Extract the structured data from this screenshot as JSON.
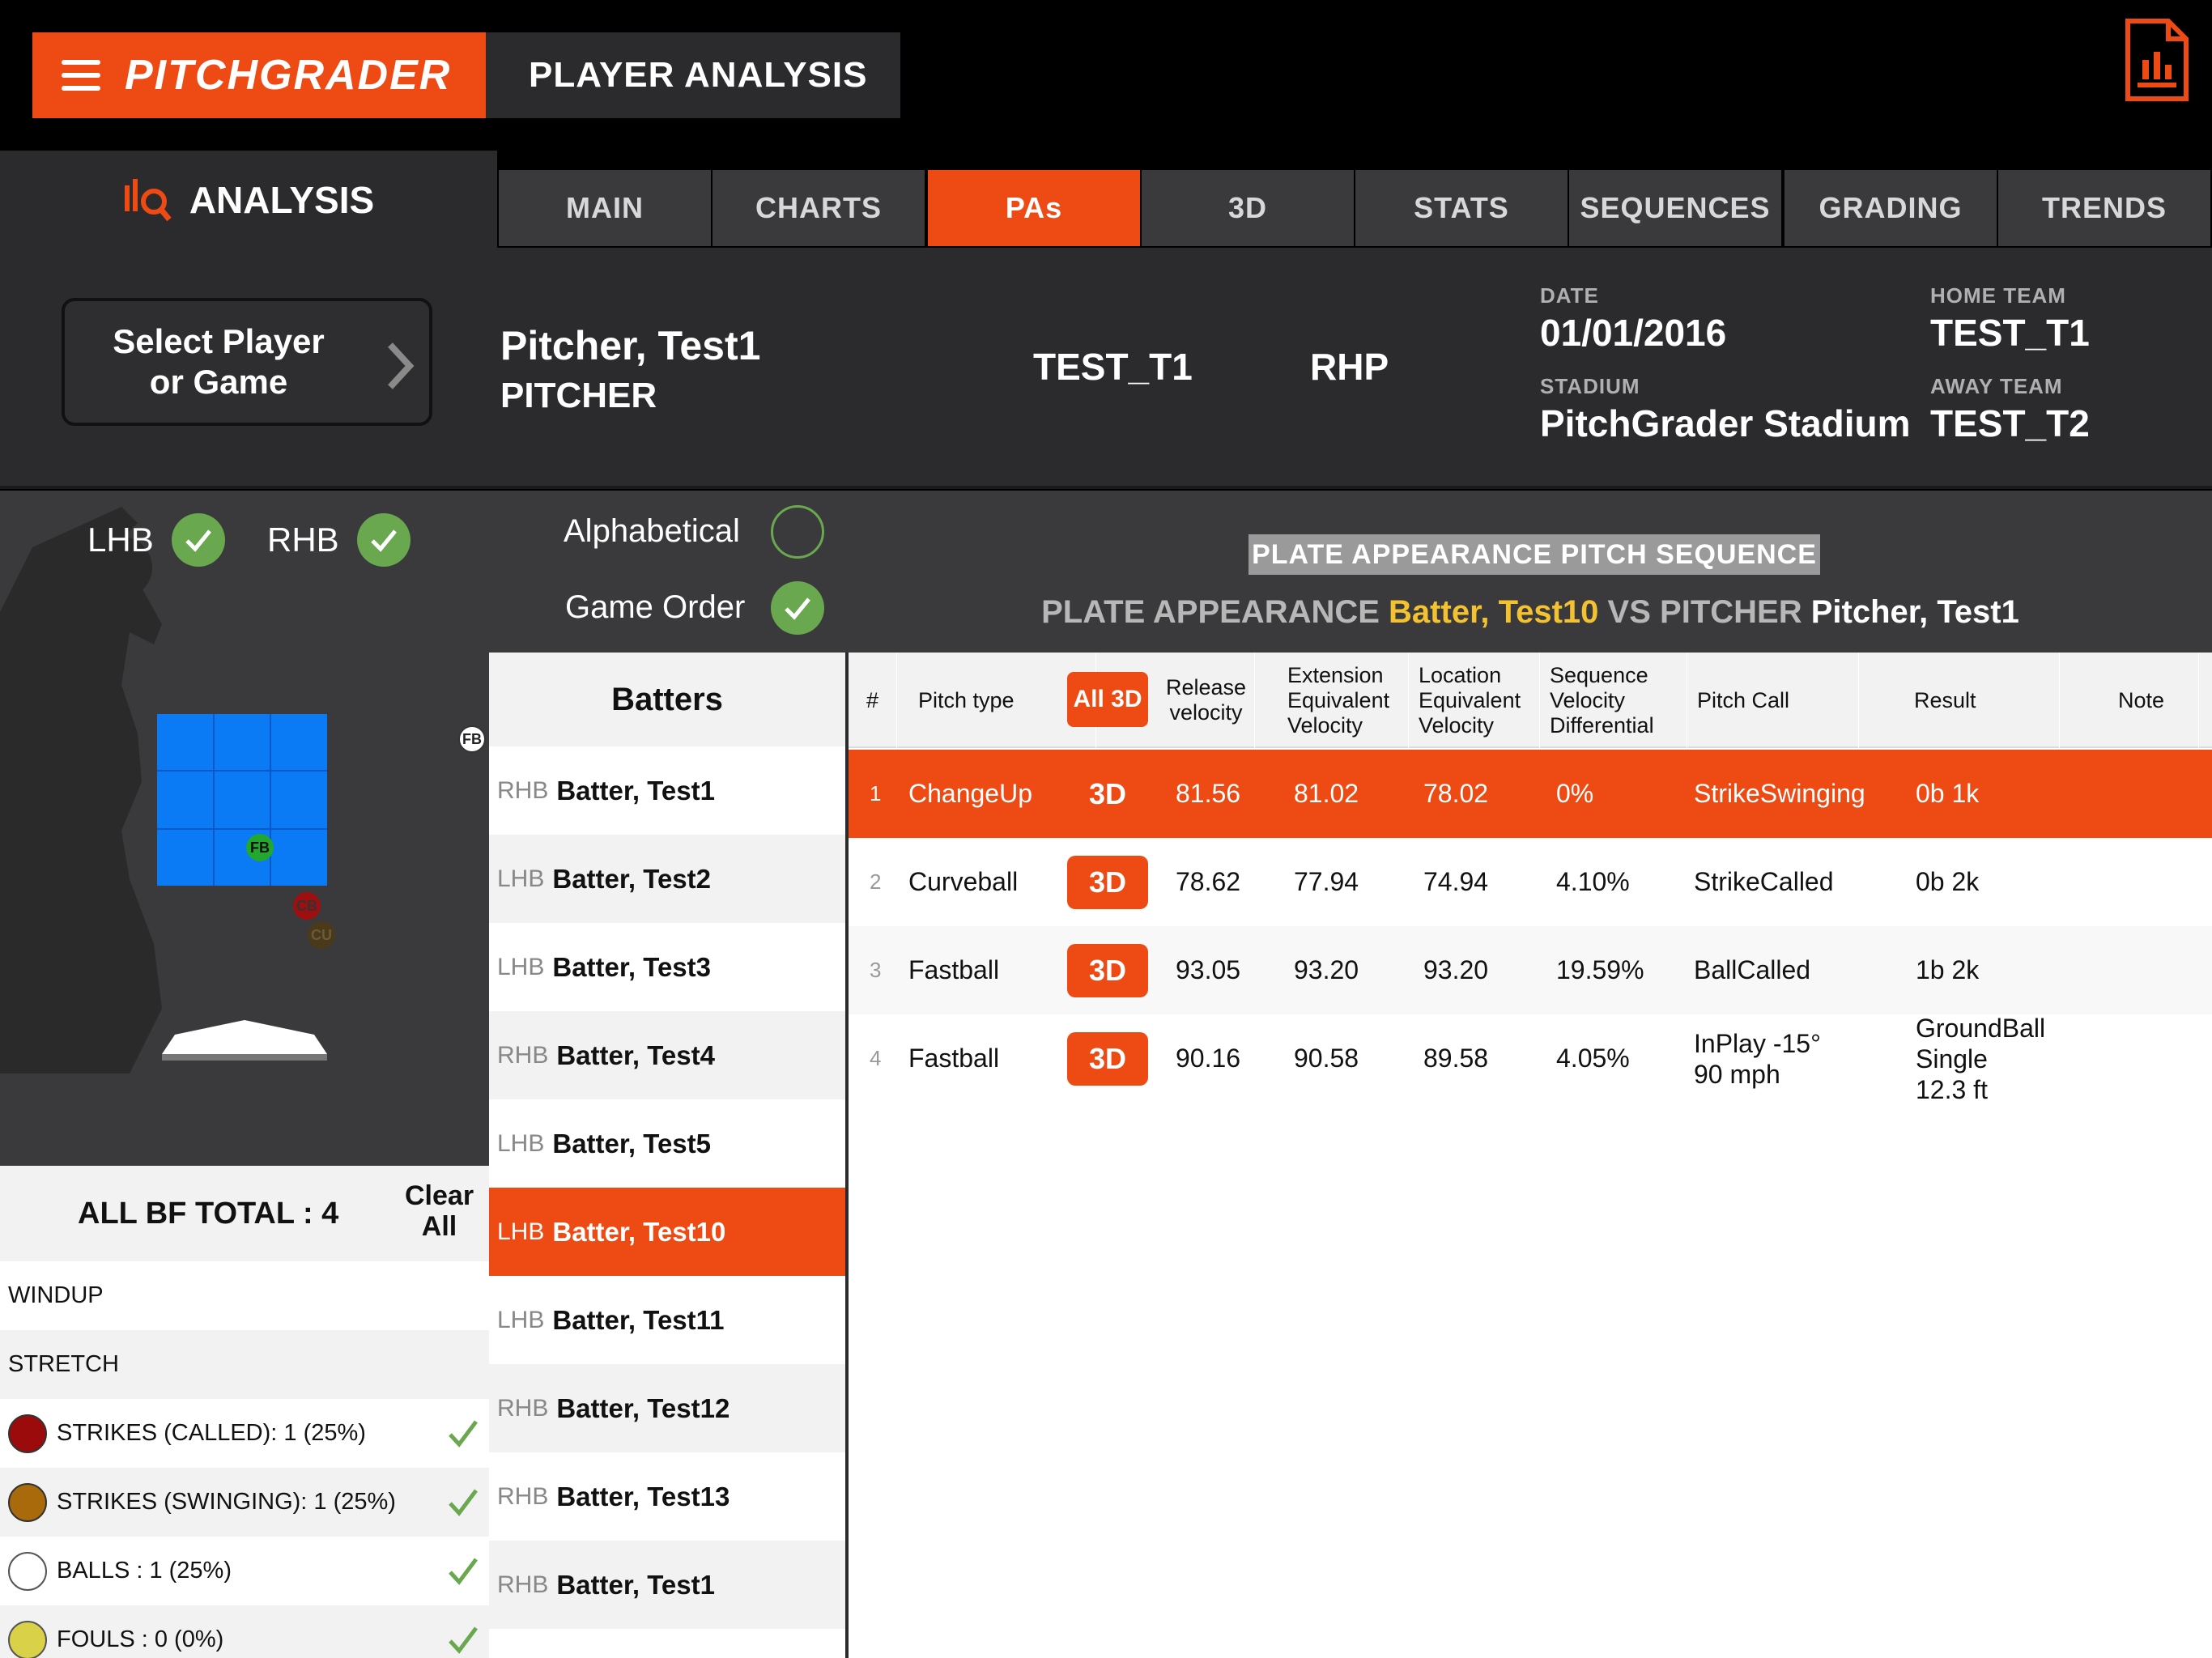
{
  "app": {
    "brand": "PITCHGRADER",
    "page_title": "PLAYER ANALYSIS",
    "section_title": "ANALYSIS"
  },
  "tabs": [
    {
      "label": "MAIN",
      "active": false
    },
    {
      "label": "CHARTS",
      "active": false
    },
    {
      "label": "PAs",
      "active": true
    },
    {
      "label": "3D",
      "active": false
    },
    {
      "label": "STATS",
      "active": false
    },
    {
      "label": "SEQUENCES",
      "active": false
    },
    {
      "label": "GRADING",
      "active": false
    },
    {
      "label": "TRENDS",
      "active": false
    }
  ],
  "info": {
    "select_label": "Select Player\nor Game",
    "player_name": "Pitcher, Test1",
    "player_role": "PITCHER",
    "team_code": "TEST_T1",
    "hand": "RHP",
    "date_label": "DATE",
    "date": "01/01/2016",
    "stadium_label": "STADIUM",
    "stadium": "PitchGrader Stadium",
    "home_label": "HOME TEAM",
    "home_team": "TEST_T1",
    "away_label": "AWAY TEAM",
    "away_team": "TEST_T2"
  },
  "zone": {
    "lhb_label": "LHB",
    "rhb_label": "RHB",
    "pitch_labels": {
      "fb_outside": "FB",
      "fb": "FB",
      "cb": "CB",
      "cu": "CU"
    }
  },
  "stats": {
    "total_label": "ALL BF TOTAL : 4",
    "clear_label": "Clear\nAll",
    "windup": "WINDUP",
    "stretch": "STRETCH",
    "rows": [
      {
        "label": "STRIKES (CALLED): 1 (25%)",
        "color": "#9b0b0b"
      },
      {
        "label": "STRIKES (SWINGING): 1 (25%)",
        "color": "#a86a0a"
      },
      {
        "label": "BALLS : 1 (25%)",
        "color": "#ffffff"
      },
      {
        "label": "FOULS : 0 (0%)",
        "color": "#d9d148"
      }
    ]
  },
  "order": {
    "alphabetical": "Alphabetical",
    "game_order": "Game Order"
  },
  "batters": {
    "header": "Batters",
    "rows": [
      {
        "hand": "RHB",
        "name": "Batter, Test1"
      },
      {
        "hand": "LHB",
        "name": "Batter, Test2"
      },
      {
        "hand": "LHB",
        "name": "Batter, Test3"
      },
      {
        "hand": "RHB",
        "name": "Batter, Test4"
      },
      {
        "hand": "LHB",
        "name": "Batter, Test5"
      },
      {
        "hand": "LHB",
        "name": "Batter, Test10"
      },
      {
        "hand": "LHB",
        "name": "Batter, Test11"
      },
      {
        "hand": "RHB",
        "name": "Batter, Test12"
      },
      {
        "hand": "RHB",
        "name": "Batter, Test13"
      },
      {
        "hand": "RHB",
        "name": "Batter, Test1"
      }
    ]
  },
  "sequence": {
    "title": "PLATE APPEARANCE PITCH SEQUENCE",
    "sub_pa": "PLATE APPEARANCE",
    "sub_batter": "Batter, Test10",
    "sub_vs": "VS PITCHER",
    "sub_pitcher": "Pitcher, Test1",
    "columns": {
      "num": "#",
      "pitch_type": "Pitch type",
      "all3d": "All 3D",
      "release": "Release\nvelocity",
      "extension": "Extension\nEquivalent\nVelocity",
      "location": "Location\nEquivalent\nVelocity",
      "sequence": "Sequence\nVelocity\nDifferential",
      "call": "Pitch Call",
      "result": "Result",
      "note": "Note"
    },
    "btn_3d": "3D",
    "rows": [
      {
        "num": "1",
        "type": "ChangeUp",
        "release": "81.56",
        "ext": "81.02",
        "loc": "78.02",
        "seq": "0%",
        "call": "StrikeSwinging",
        "result": "0b 1k"
      },
      {
        "num": "2",
        "type": "Curveball",
        "release": "78.62",
        "ext": "77.94",
        "loc": "74.94",
        "seq": "4.10%",
        "call": "StrikeCalled",
        "result": "0b 2k"
      },
      {
        "num": "3",
        "type": "Fastball",
        "release": "93.05",
        "ext": "93.20",
        "loc": "93.20",
        "seq": "19.59%",
        "call": "BallCalled",
        "result": "1b 2k"
      },
      {
        "num": "4",
        "type": "Fastball",
        "release": "90.16",
        "ext": "90.58",
        "loc": "89.58",
        "seq": "4.05%",
        "call": "InPlay -15°\n90 mph",
        "result": "GroundBall\nSingle\n12.3 ft"
      }
    ]
  },
  "colors": {
    "accent": "#ee4a13",
    "check_green": "#6aa84f",
    "highlight_yellow": "#f2c230"
  }
}
